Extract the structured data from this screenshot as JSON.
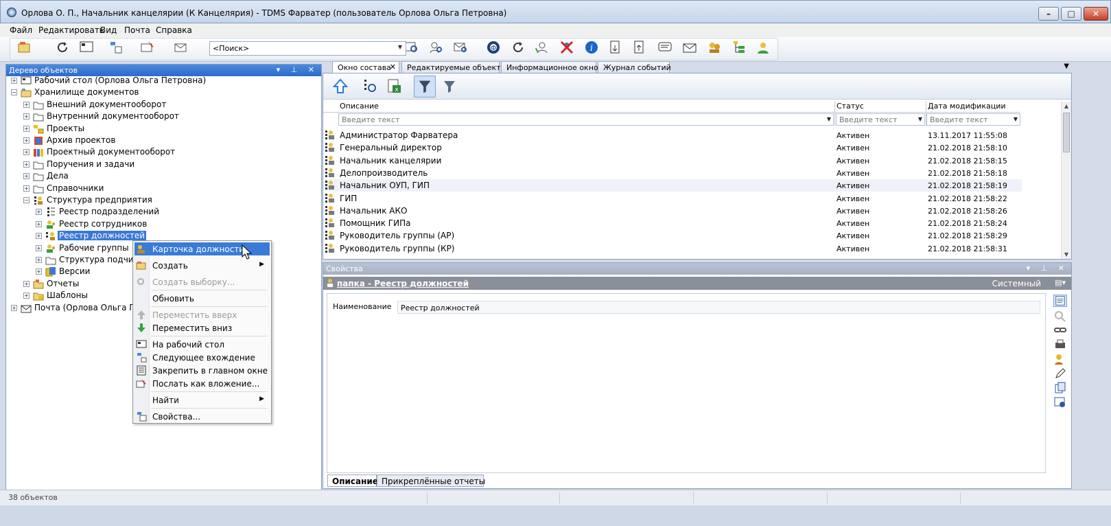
{
  "window": {
    "title": "Орлова О. П., Начальник канцелярии (К Канцелярия) - TDMS Фарватер (пользователь Орлова Ольга Петровна)"
  },
  "menu": [
    "Файл",
    "Редактировать",
    "Вид",
    "Почта",
    "Справка"
  ],
  "toolbar": {
    "search_value": "<Поиск>"
  },
  "tree": {
    "header": "Дерево объектов",
    "items": [
      "Рабочий стол (Орлова Ольга Петровна)",
      "Хранилище документов",
      "Внешний документооборот",
      "Внутренний документооборот",
      "Проекты",
      "Архив проектов",
      "Проектный документооборот",
      "Поручения и задачи",
      "Дела",
      "Справочники",
      "Структура предприятия",
      "Реестр подразделений",
      "Реестр сотрудников",
      "Реестр должностей",
      "Рабочие группы",
      "Структура подчине",
      "Версии",
      "Отчеты",
      "Шаблоны",
      "Почта (Орлова Ольга Петр"
    ]
  },
  "context_menu": {
    "items": [
      "Карточка должности",
      "Создать",
      "Создать выборку...",
      "Обновить",
      "Переместить вверх",
      "Переместить вниз",
      "На рабочий стол",
      "Следующее вхождение",
      "Закрепить в главном окне",
      "Послать как вложение...",
      "Найти",
      "Свойства..."
    ]
  },
  "tabs": [
    "Окно состава",
    "Редактируемые объекты",
    "Информационное окно",
    "Журнал событий"
  ],
  "grid": {
    "columns": [
      "Описание",
      "Статус",
      "Дата модификации"
    ],
    "filter_placeholder": "Введите текст",
    "rows": [
      {
        "name": "Администратор Фарватера",
        "status": "Активен",
        "date": "13.11.2017 11:55:08"
      },
      {
        "name": "Генеральный директор",
        "status": "Активен",
        "date": "21.02.2018 21:58:10"
      },
      {
        "name": "Начальник канцелярии",
        "status": "Активен",
        "date": "21.02.2018 21:58:15"
      },
      {
        "name": "Делопроизводитель",
        "status": "Активен",
        "date": "21.02.2018 21:58:18"
      },
      {
        "name": "Начальник ОУП, ГИП",
        "status": "Активен",
        "date": "21.02.2018 21:58:19"
      },
      {
        "name": "ГИП",
        "status": "Активен",
        "date": "21.02.2018 21:58:22"
      },
      {
        "name": "Начальник АКО",
        "status": "Активен",
        "date": "21.02.2018 21:58:26"
      },
      {
        "name": "Помощник ГИПа",
        "status": "Активен",
        "date": "21.02.2018 21:58:24"
      },
      {
        "name": "Руководитель группы (АР)",
        "status": "Активен",
        "date": "21.02.2018 21:58:29"
      },
      {
        "name": "Руководитель группы (КР)",
        "status": "Активен",
        "date": "21.02.2018 21:58:31"
      }
    ]
  },
  "properties": {
    "header": "Свойства",
    "object_title": "папка - Реестр должностей",
    "object_type": "Системный",
    "field_label": "Наименование",
    "field_value": "Реестр должностей",
    "tabs": [
      "Описание",
      "Прикреплённые отчеты"
    ]
  },
  "status": {
    "count": "38 объектов"
  },
  "colors": {
    "accent": "#3a78d6",
    "pane_header": "#2b6bc7"
  }
}
